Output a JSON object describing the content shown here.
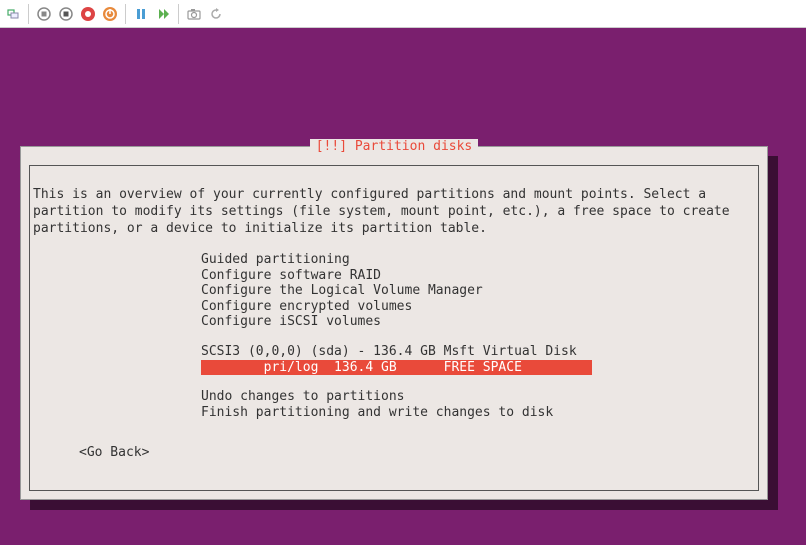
{
  "toolbar": {
    "icons": [
      "devices",
      "stop-outline",
      "stop",
      "record",
      "power",
      "pause",
      "play",
      "camera",
      "refresh"
    ]
  },
  "dialog": {
    "title": "[!!] Partition disks",
    "intro": "This is an overview of your currently configured partitions and mount points. Select a partition to modify its settings (file system, mount point, etc.), a free space to create partitions, or a device to initialize its partition table.",
    "menu_group1": [
      "Guided partitioning",
      "Configure software RAID",
      "Configure the Logical Volume Manager",
      "Configure encrypted volumes",
      "Configure iSCSI volumes"
    ],
    "disk_header": "SCSI3 (0,0,0) (sda) - 136.4 GB Msft Virtual Disk",
    "disk_row": "        pri/log  136.4 GB      FREE SPACE         ",
    "menu_group2": [
      "Undo changes to partitions",
      "Finish partitioning and write changes to disk"
    ],
    "go_back": "<Go Back>"
  }
}
